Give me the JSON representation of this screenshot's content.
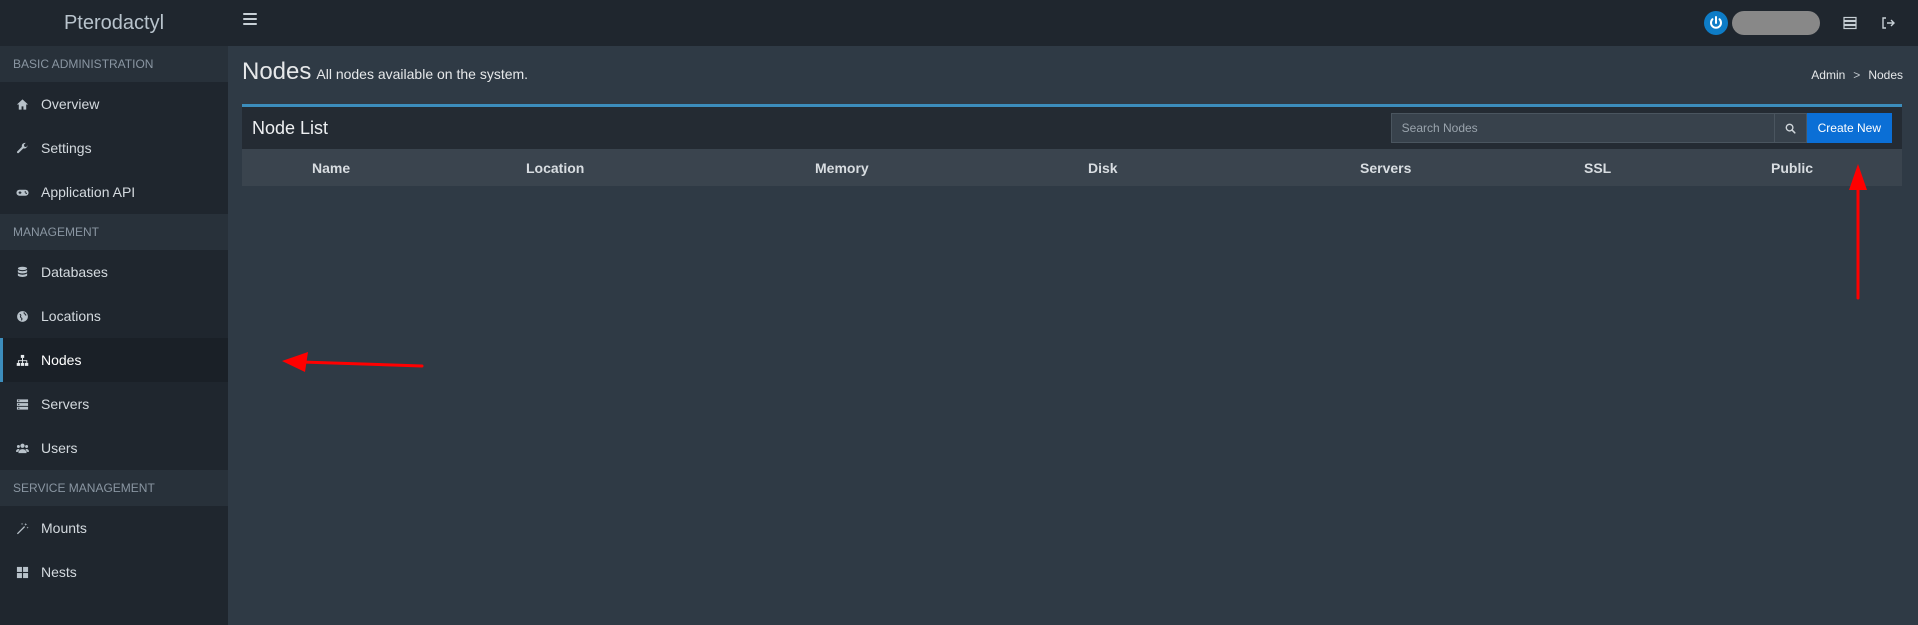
{
  "app": {
    "brand": "Pterodactyl"
  },
  "topbar": {
    "icons": [
      "power-icon",
      "server-list-icon",
      "sign-out-icon"
    ]
  },
  "sidebar": {
    "sections": [
      {
        "header": "BASIC ADMINISTRATION",
        "items": [
          {
            "label": "Overview",
            "icon": "home-icon"
          },
          {
            "label": "Settings",
            "icon": "wrench-icon"
          },
          {
            "label": "Application API",
            "icon": "gamepad-icon"
          }
        ]
      },
      {
        "header": "MANAGEMENT",
        "items": [
          {
            "label": "Databases",
            "icon": "database-icon"
          },
          {
            "label": "Locations",
            "icon": "globe-icon"
          },
          {
            "label": "Nodes",
            "icon": "sitemap-icon",
            "active": true
          },
          {
            "label": "Servers",
            "icon": "server-icon"
          },
          {
            "label": "Users",
            "icon": "users-icon"
          }
        ]
      },
      {
        "header": "SERVICE MANAGEMENT",
        "items": [
          {
            "label": "Mounts",
            "icon": "magic-icon"
          },
          {
            "label": "Nests",
            "icon": "th-large-icon"
          }
        ]
      }
    ]
  },
  "page": {
    "title": "Nodes",
    "subtitle": "All nodes available on the system."
  },
  "breadcrumb": {
    "items": [
      "Admin",
      "Nodes"
    ],
    "separator": ">"
  },
  "node_list": {
    "title": "Node List",
    "search_placeholder": "Search Nodes",
    "create_label": "Create New",
    "columns": [
      "Name",
      "Location",
      "Memory",
      "Disk",
      "Servers",
      "SSL",
      "Public"
    ],
    "rows": []
  },
  "colors": {
    "accent": "#3c8dbc",
    "button": "#0b6fd6",
    "annotation_arrow": "#ff0000"
  }
}
